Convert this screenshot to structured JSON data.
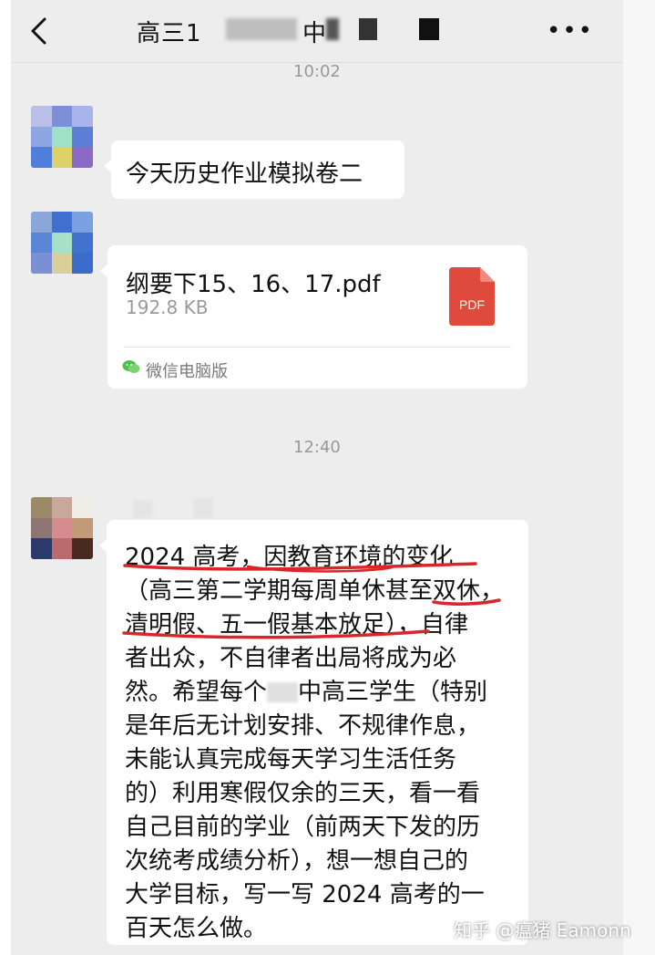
{
  "header": {
    "back_label": "<",
    "title": "高三1",
    "title_tail": "中",
    "more_label": "•••"
  },
  "timestamps": {
    "top": "10:02",
    "middle": "12:40"
  },
  "messages": {
    "m1": {
      "text": "今天历史作业模拟卷二"
    },
    "m2": {
      "file_name": "纲要下15、16、17.pdf",
      "file_size": "192.8 KB",
      "file_type": "PDF",
      "source": "微信电脑版",
      "pdf_color": "#e04a3c",
      "source_icon_color": "#4cbf4a"
    },
    "m3": {
      "lines": [
        "2024 高考，因教育环境的变化",
        "（高三第二学期每周单休甚至双休，",
        "清明假、五一假基本放足），自律",
        "者出众，不自律者出局将成为必",
        "然。希望每个",
        "是年后无计划安排、不规律作息，",
        "未能认真完成每天学习生活任务",
        "的）利用寒假仅余的三天，看一看",
        "自己目前的学业（前两天下发的历",
        "次统考成绩分析），想一想自己的",
        "大学目标，写一写 2024 高考的一",
        "百天怎么做。"
      ],
      "line5_tail": "中高三学生（特别",
      "underline_color": "#d8262a"
    }
  },
  "watermark": "知乎 @瘟猪 Eamonn"
}
